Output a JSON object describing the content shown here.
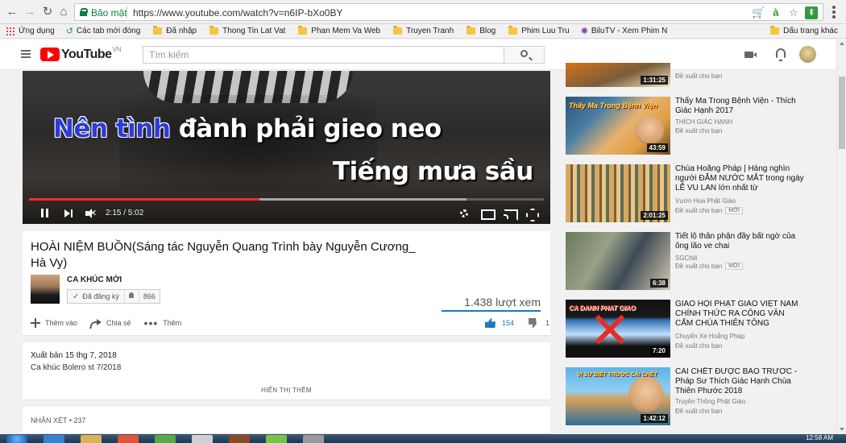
{
  "browser": {
    "secure_label": "Bảo mật",
    "url": "https://www.youtube.com/watch?v=n6IP-bXo0BY",
    "bookmarks": [
      {
        "label": "Ứng dụng",
        "icon": "apps-icon"
      },
      {
        "label": "Các tab mới đóng",
        "icon": "history-icon"
      },
      {
        "label": "Đã nhập",
        "icon": "folder-icon"
      },
      {
        "label": "Thong Tin Lat Vat",
        "icon": "folder-icon"
      },
      {
        "label": "Phan Mem Va Web",
        "icon": "folder-icon"
      },
      {
        "label": "Truyen Tranh",
        "icon": "folder-icon"
      },
      {
        "label": "Blog",
        "icon": "folder-icon"
      },
      {
        "label": "Phim Luu Tru",
        "icon": "folder-icon"
      },
      {
        "label": "BiluTV - Xem Phim N",
        "icon": "bilutv-icon"
      }
    ],
    "other_bookmarks": "Dấu trang khác"
  },
  "youtube": {
    "logo_text": "YouTube",
    "country": "VN",
    "search_placeholder": "Tìm kiếm"
  },
  "player": {
    "lyric_line1_highlight": "Nên tình",
    "lyric_line1_rest": " đành phải gieo neo",
    "lyric_line2": "Tiếng mưa sầu",
    "time_display": "2:15 / 5:02",
    "progress_fraction": 0.447,
    "buffer_fraction": 0.85,
    "colors": {
      "progress": "#f12b24"
    }
  },
  "video": {
    "title": "HOÀI NIỆM BUỒN(Sáng tác Nguyễn Quang Trình bày Nguyễn Cương_ Hà Vy)",
    "channel_name": "CA KHÚC MỚI",
    "subscribed_label": "Đã đăng ký",
    "subscriber_count": "866",
    "view_count": "1.438 lượt xem",
    "add_label": "Thêm vào",
    "share_label": "Chia sẻ",
    "more_label": "Thêm",
    "like_count": "154",
    "dislike_count": "1",
    "published": "Xuất bản 15 thg 7, 2018",
    "description": "Ca khúc Bolero st 7/2018",
    "show_more": "HIỂN THỊ THÊM",
    "comments_header": "NHẬN XÉT • 237"
  },
  "related": [
    {
      "title": "",
      "channel": "",
      "rec": "Đề xuất cho bạn",
      "duration": "1:31:25",
      "new": ""
    },
    {
      "title": "Thấy Ma Trong Bệnh Viện - Thích Giác Hạnh 2017",
      "channel": "THÍCH GIÁC HẠNH",
      "rec": "Đề xuất cho bạn",
      "duration": "43:59",
      "new": ""
    },
    {
      "title": "Chùa Hoằng Pháp | Hàng nghìn người ĐẪM NƯỚC MẮT trong ngày LỄ VU LAN lớn nhất từ",
      "channel": "Vườn Hoa Phật Giáo",
      "rec": "Đề xuất cho bạn",
      "duration": "2:01:25",
      "new": "MỚI"
    },
    {
      "title": "Tiết lộ thân phận đầy bất ngờ của ông lão ve chai",
      "channel": "SGChill",
      "rec": "Đề xuất cho bạn",
      "duration": "6:38",
      "new": "MỚI"
    },
    {
      "title": "GIÁO HỘI PHẬT GIÁO VIỆT NAM CHÍNH THỨC RA CÔNG VĂN CẤM CHÙA THIÊN TÔNG",
      "channel": "Chuyển Xe Hoằng Pháp",
      "rec": "Đề xuất cho bạn",
      "duration": "7:20",
      "new": ""
    },
    {
      "title": "CÁI CHẾT ĐƯỢC BÁO TRƯỚC - Pháp Sư Thích Giác Hạnh Chùa Thiên Phước 2018",
      "channel": "Truyền Thông Phật Giáo",
      "rec": "Đề xuất cho bạn",
      "duration": "1:42:12",
      "new": ""
    }
  ],
  "thumb_text": {
    "t2": "Thấy Ma Trong Bệnh Viện",
    "t5": "CA DANH PHAT GIAO",
    "t6": "VỊ SƯ BIẾT TRƯỚC CÁI CHẾT"
  },
  "taskbar": {
    "clock": "12:58 AM"
  }
}
